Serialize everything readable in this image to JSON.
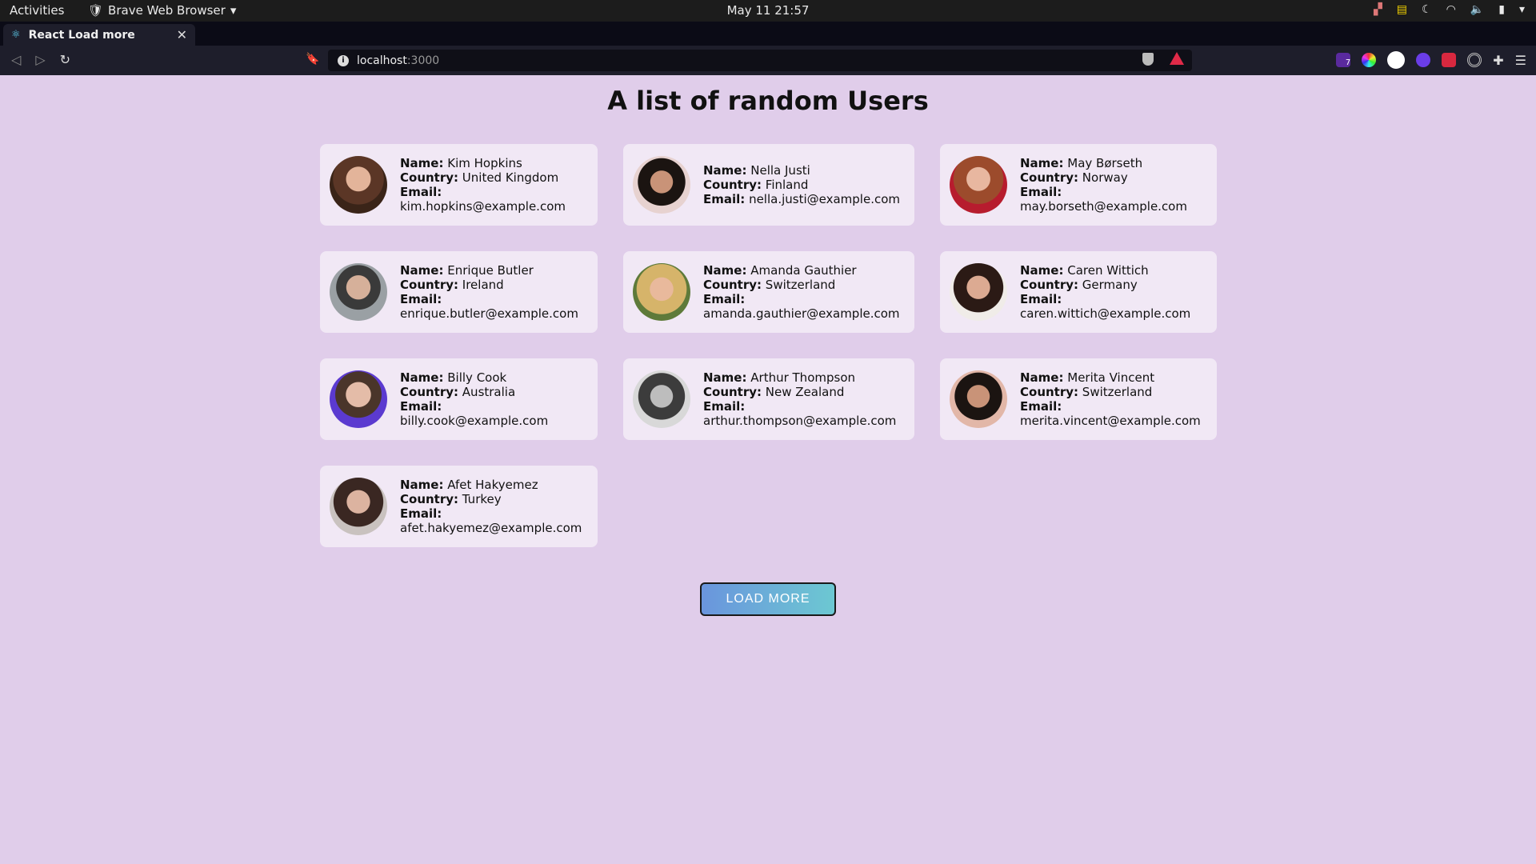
{
  "topbar": {
    "activities": "Activities",
    "app_name": "Brave Web Browser",
    "clock": "May 11  21:57"
  },
  "browser": {
    "tab_title": "React Load more",
    "url_host": "localhost",
    "url_port": ":3000",
    "extension_badge": "7"
  },
  "page": {
    "heading": "A list of random Users",
    "labels": {
      "name": "Name:",
      "country": "Country:",
      "email": "Email:"
    },
    "users": [
      {
        "name": "Kim Hopkins",
        "country": "United Kingdom",
        "email": "kim.hopkins@example.com"
      },
      {
        "name": "Nella Justi",
        "country": "Finland",
        "email": "nella.justi@example.com"
      },
      {
        "name": "May Børseth",
        "country": "Norway",
        "email": "may.borseth@example.com"
      },
      {
        "name": "Enrique Butler",
        "country": "Ireland",
        "email": "enrique.butler@example.com"
      },
      {
        "name": "Amanda Gauthier",
        "country": "Switzerland",
        "email": "amanda.gauthier@example.com"
      },
      {
        "name": "Caren Wittich",
        "country": "Germany",
        "email": "caren.wittich@example.com"
      },
      {
        "name": "Billy Cook",
        "country": "Australia",
        "email": "billy.cook@example.com"
      },
      {
        "name": "Arthur Thompson",
        "country": "New Zealand",
        "email": "arthur.thompson@example.com"
      },
      {
        "name": "Merita Vincent",
        "country": "Switzerland",
        "email": "merita.vincent@example.com"
      },
      {
        "name": "Afet Hakyemez",
        "country": "Turkey",
        "email": "afet.hakyemez@example.com"
      }
    ],
    "load_more_label": "LOAD MORE"
  },
  "colors": {
    "page_background": "#e0cdea",
    "card_background": "#f1e8f5",
    "button_gradient_start": "#6a95dd",
    "button_gradient_end": "#6cc8d2"
  }
}
